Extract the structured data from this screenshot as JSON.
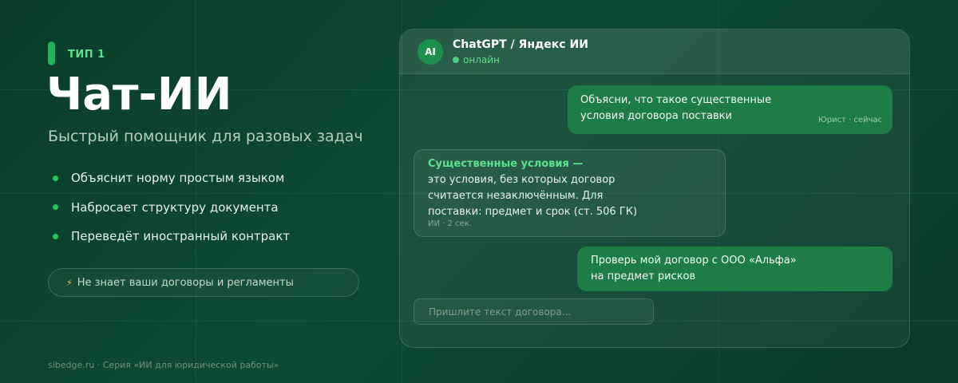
{
  "left": {
    "type_label": "ТИП 1",
    "title": "Чат-ИИ",
    "subtitle": "Быстрый помощник для разовых задач",
    "features": [
      "Объяснит норму простым языком",
      "Набросает структуру документа",
      "Переведёт иностранный контракт"
    ],
    "warning_icon": "⚡",
    "warning": "Не знает ваши договоры и регламенты",
    "footer": "sibedge.ru · Серия «ИИ для юридической работы»"
  },
  "chat": {
    "avatar": "AI",
    "name": "ChatGPT / Яндекс ИИ",
    "status": "онлайн",
    "messages": [
      {
        "line1": "Объясни, что такое существенные",
        "line2": "условия договора поставки",
        "meta": "Юрист · сейчас"
      },
      {
        "heading": "Существенные условия —",
        "line1": "это условия, без которых договор",
        "line2": "считается незаключённым. Для",
        "line3": "поставки: предмет и срок (ст. 506 ГК)",
        "meta": "ИИ · 2 сек."
      },
      {
        "line1": "Проверь мой договор с ООО «Альфа»",
        "line2": "на предмет рисков"
      }
    ],
    "input_placeholder": "Пришлите текст договора..."
  },
  "colors": {
    "accent": "#22b35c",
    "accent_text": "#5fe08e",
    "user_bubble": "#1e7d46",
    "bolt": "#f5c842"
  },
  "icons": {
    "warning": "lightning-bolt-icon",
    "status": "online-dot-icon"
  }
}
